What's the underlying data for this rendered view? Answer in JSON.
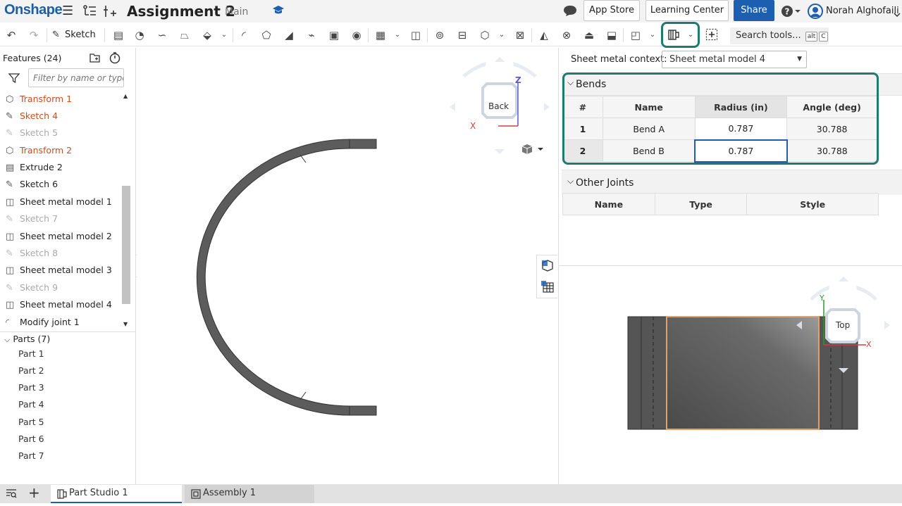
{
  "topbar": {
    "logo": "Onshape",
    "title": "Assignment 2",
    "branch": "Main",
    "app_store": "App Store",
    "learning_center": "Learning Center",
    "share": "Share",
    "user_name": "Norah Alghofaili",
    "help": "?"
  },
  "toolbar": {
    "sketch_label": "Sketch",
    "search_label": "Search tools...",
    "kbd_alt": "alt",
    "kbd_c": "C"
  },
  "features": {
    "header": "Features (24)",
    "filter_placeholder": "Filter by name or type",
    "items": [
      {
        "label": "Transform 1",
        "icon": "transform-icon"
      },
      {
        "label": "Sketch 4",
        "icon": "sketch-icon"
      },
      {
        "label": "Sketch 5",
        "icon": "sketch-icon"
      },
      {
        "label": "Transform 2",
        "icon": "transform-icon"
      },
      {
        "label": "Extrude 2",
        "icon": "extrude-icon"
      },
      {
        "label": "Sketch 6",
        "icon": "sketch-icon"
      },
      {
        "label": "Sheet metal model 1",
        "icon": "sheet-metal-icon"
      },
      {
        "label": "Sketch 7",
        "icon": "sketch-icon"
      },
      {
        "label": "Sheet metal model 2",
        "icon": "sheet-metal-icon"
      },
      {
        "label": "Sketch 8",
        "icon": "sketch-icon"
      },
      {
        "label": "Sheet metal model 3",
        "icon": "sheet-metal-icon"
      },
      {
        "label": "Sketch 9",
        "icon": "sketch-icon"
      },
      {
        "label": "Sheet metal model 4",
        "icon": "sheet-metal-icon"
      },
      {
        "label": "Modify joint 1",
        "icon": "modify-joint-icon"
      }
    ],
    "parts_header": "Parts (7)",
    "parts": [
      "Part 1",
      "Part 2",
      "Part 3",
      "Part 4",
      "Part 5",
      "Part 6",
      "Part 7"
    ]
  },
  "viewport": {
    "view_cube_label": "Back",
    "axis_z": "Z",
    "axis_x": "X"
  },
  "sheet_metal": {
    "context_label": "Sheet metal context:",
    "context_value": "Sheet metal model 4",
    "bends_header": "Bends",
    "bends_columns": [
      "#",
      "Name",
      "Radius (in)",
      "Angle (deg)"
    ],
    "bends": [
      {
        "num": "1",
        "name": "Bend A",
        "radius": "0.787",
        "angle": "30.788"
      },
      {
        "num": "2",
        "name": "Bend B",
        "radius": "0.787",
        "angle": "30.788"
      }
    ],
    "joints_header": "Other Joints",
    "joints_columns": [
      "Name",
      "Type",
      "Style"
    ]
  },
  "flat_view": {
    "view_cube_label": "Top",
    "axis_y": "Y",
    "axis_x": "X"
  },
  "tabs": {
    "part_studio": "Part Studio 1",
    "assembly": "Assembly 1"
  },
  "colors": {
    "accent": "#1c5fb0",
    "highlight": "#1e7b6e",
    "feature_active": "#c8501c"
  }
}
